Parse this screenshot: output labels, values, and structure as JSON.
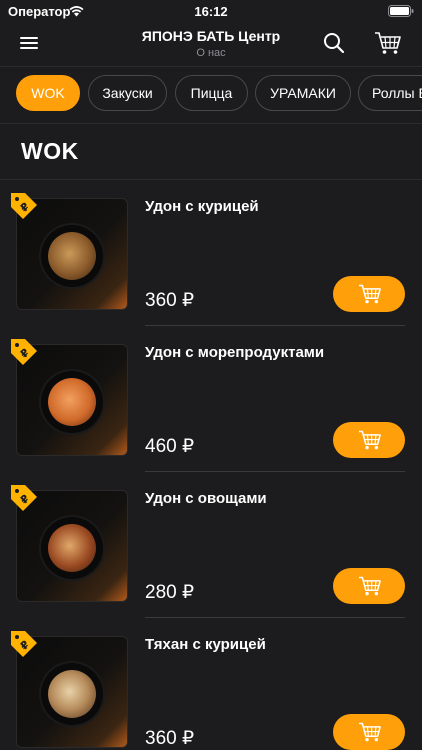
{
  "status_bar": {
    "carrier": "Оператор",
    "time": "16:12"
  },
  "header": {
    "title": "ЯПОНЭ БАТЬ Центр",
    "subtitle": "О нас"
  },
  "tabs": [
    {
      "label": "WOK",
      "active": true
    },
    {
      "label": "Закуски",
      "active": false
    },
    {
      "label": "Пицца",
      "active": false
    },
    {
      "label": "УРАМАКИ",
      "active": false
    },
    {
      "label": "Роллы Б",
      "active": false
    }
  ],
  "section": {
    "title": "WOK"
  },
  "items": [
    {
      "name": "Удон с курицей",
      "price": "360 ₽",
      "food_color": "#8a5a2a"
    },
    {
      "name": "Удон с морепродуктами",
      "price": "460 ₽",
      "food_color": "#d06a2a"
    },
    {
      "name": "Удон с овощами",
      "price": "280 ₽",
      "food_color": "#9a4a22"
    },
    {
      "name": "Тяхан с курицей",
      "price": "360 ₽",
      "food_color": "#b58a5a"
    }
  ],
  "colors": {
    "accent": "#ff9f0a",
    "background": "#1c1c1e"
  },
  "icons": {
    "menu": "hamburger-icon",
    "search": "search-icon",
    "cart": "cart-icon",
    "badge": "ruble-tag-icon"
  }
}
